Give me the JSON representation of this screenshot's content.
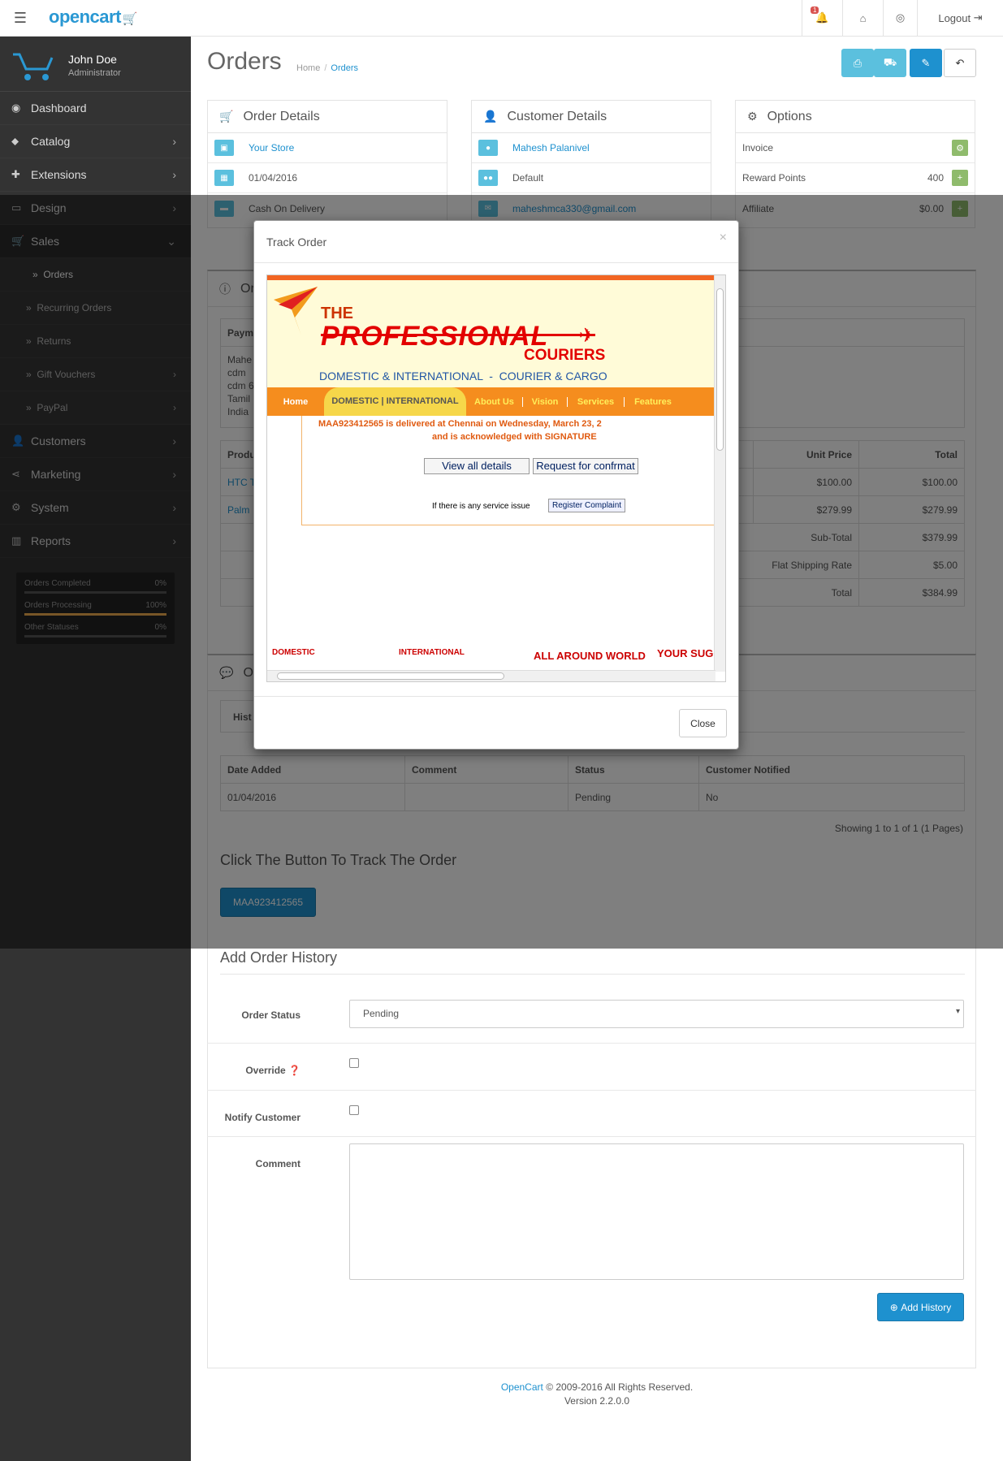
{
  "header": {
    "logo": "opencart",
    "notifications_count": "1",
    "logout": "Logout"
  },
  "profile": {
    "name": "John Doe",
    "role": "Administrator"
  },
  "nav": {
    "dashboard": "Dashboard",
    "catalog": "Catalog",
    "extensions": "Extensions",
    "design": "Design",
    "sales": "Sales",
    "sales_sub": {
      "orders": "Orders",
      "recurring": "Recurring Orders",
      "returns": "Returns",
      "gift": "Gift Vouchers",
      "paypal": "PayPal"
    },
    "customers": "Customers",
    "marketing": "Marketing",
    "system": "System",
    "reports": "Reports"
  },
  "stats": [
    {
      "label": "Orders Completed",
      "value": "0%",
      "fill": 0
    },
    {
      "label": "Orders Processing",
      "value": "100%",
      "fill": 100
    },
    {
      "label": "Other Statuses",
      "value": "0%",
      "fill": 0
    }
  ],
  "page": {
    "title": "Orders",
    "breadcrumb_home": "Home",
    "breadcrumb_current": "Orders"
  },
  "order_details": {
    "title": "Order Details",
    "store": "Your Store",
    "date": "01/04/2016",
    "payment": "Cash On Delivery"
  },
  "customer_details": {
    "title": "Customer Details",
    "name": "Mahesh Palanivel",
    "group": "Default",
    "email": "maheshmca330@gmail.com"
  },
  "options": {
    "title": "Options",
    "invoice": "Invoice",
    "reward": "Reward Points",
    "reward_value": "400",
    "affiliate": "Affiliate",
    "affiliate_value": "$0.00"
  },
  "order_panel": {
    "title_partial": "Or",
    "payment_header": "Paym",
    "address_lines": [
      "Mahe",
      "cdm",
      "cdm 6",
      "Tamil",
      "India"
    ],
    "product_header": "Produ",
    "unit_price_header": "Unit Price",
    "total_header": "Total",
    "products": [
      {
        "name": "HTC T",
        "unit": "$100.00",
        "total": "$100.00"
      },
      {
        "name": "Palm",
        "unit": "$279.99",
        "total": "$279.99"
      }
    ],
    "totals": [
      {
        "label": "Sub-Total",
        "value": "$379.99"
      },
      {
        "label": "Flat Shipping Rate",
        "value": "$5.00"
      },
      {
        "label": "Total",
        "value": "$384.99"
      }
    ]
  },
  "history_panel": {
    "title_partial": "O",
    "tab": "Hist",
    "cols": [
      "Date Added",
      "Comment",
      "Status",
      "Customer Notified"
    ],
    "rows": [
      [
        "01/04/2016",
        "",
        "Pending",
        "No"
      ]
    ],
    "showing": "Showing 1 to 1 of 1 (1 Pages)",
    "track_heading": "Click The Button To Track The Order",
    "track_button": "MAA923412565"
  },
  "add_history": {
    "heading": "Add Order History",
    "status_label": "Order Status",
    "status_value": "Pending",
    "override_label": "Override",
    "notify_label": "Notify Customer",
    "comment_label": "Comment",
    "add_button": "Add History"
  },
  "footer": {
    "link": "OpenCart",
    "copy": "© 2009-2016 All Rights Reserved.",
    "version": "Version 2.2.0.0"
  },
  "modal": {
    "title": "Track Order",
    "close_x": "×",
    "close": "Close",
    "courier": {
      "brand_the": "THE",
      "brand_main": "PROFESSIONAL",
      "brand_sub": "COURIERS",
      "tagline": "DOMESTIC & INTERNATIONAL  -  COURIER & CARGO",
      "nav": [
        "Home",
        "DOMESTIC | INTERNATIONAL",
        "About Us",
        "Vision",
        "Services",
        "Features"
      ],
      "status_line1": "MAA923412565 is delivered at Chennai on Wednesday, March 23, 2",
      "status_line2": "and is acknowledged with SIGNATURE",
      "view_all": "View all details",
      "request": "Request for confrmat",
      "issue_text": "If there is any service issue",
      "register": "Register Complaint",
      "bottom_tabs": [
        "DOMESTIC",
        "INTERNATIONAL",
        "ALL AROUND WORLD",
        "YOUR SUGG"
      ]
    }
  }
}
